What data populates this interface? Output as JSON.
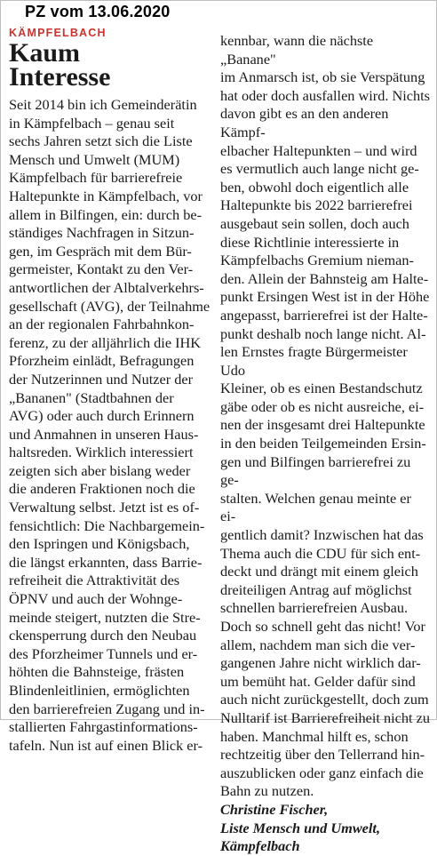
{
  "header": {
    "source_label": "PZ vom 13.06.2020"
  },
  "article": {
    "kicker": "KÄMPFELBACH",
    "title_line1": "Kaum",
    "title_line2": "Interesse",
    "left_lines": [
      "Seit 2014 bin ich Gemeinderätin",
      "in Kämpfelbach – genau seit",
      "sechs Jahren setzt sich die Liste",
      "Mensch und Umwelt (MUM)",
      "Kämpfelbach für barrierefreie",
      "Haltepunkte in Kämpfelbach, vor",
      "allem in Bilfingen, ein: durch be-",
      "ständiges Nachfragen in Sitzun-",
      "gen, im Gespräch mit dem Bür-",
      "germeister, Kontakt zu den Ver-",
      "antwortlichen der Albtalverkehrs-",
      "gesellschaft (AVG), der Teilnahme",
      "an der regionalen Fahrbahnkon-",
      "ferenz, zu der alljährlich die IHK",
      "Pforzheim einlädt, Befragungen",
      "der Nutzerinnen und Nutzer der",
      "„Bananen\" (Stadtbahnen der",
      "AVG) oder auch durch Erinnern",
      "und Anmahnen in unseren Haus-",
      "haltsreden. Wirklich interessiert",
      "zeigten sich aber bislang weder",
      "die anderen Fraktionen noch die",
      "Verwaltung selbst. Jetzt ist es of-",
      "fensichtlich: Die Nachbargemein-",
      "den Ispringen und Königsbach,",
      "die längst erkannten, dass Barrie-",
      "refreiheit die Attraktivität des",
      "ÖPNV und auch der Wohnge-",
      "meinde steigert, nutzten die Stre-",
      "ckensperrung durch den Neubau",
      "des Pforzheimer Tunnels und er-",
      "höhten die Bahnsteige, frästen",
      "Blindenleitlinien, ermöglichten",
      "den barrierefreien Zugang und in-",
      "stallierten Fahrgastinformations-",
      "tafeln. Nun ist auf einen Blick er-"
    ],
    "right_lines": [
      "kennbar, wann die nächste „Banane\"",
      "im Anmarsch ist, ob sie Verspätung",
      "hat oder doch ausfallen wird. Nichts",
      "davon gibt es an den anderen Kämpf-",
      "elbacher Haltepunkten – und wird",
      "es vermutlich auch lange nicht ge-",
      "ben, obwohl doch eigentlich alle",
      "Haltepunkte bis 2022 barrierefrei",
      "ausgebaut sein sollen, doch auch",
      "diese Richtlinie interessierte in",
      "Kämpfelbachs Gremium nieman-",
      "den. Allein der Bahnsteig am Halte-",
      "punkt Ersingen West ist in der Höhe",
      "angepasst, barrierefrei ist der Halte-",
      "punkt deshalb noch lange nicht. Al-",
      "len Ernstes fragte Bürgermeister Udo",
      "Kleiner, ob es einen Bestandschutz",
      "gäbe oder ob es nicht ausreiche, ei-",
      "nen der insgesamt drei Haltepunkte",
      "in den beiden Teilgemeinden Ersin-",
      "gen und Bilfingen barrierefrei zu ge-",
      "stalten. Welchen genau meinte er ei-",
      "gentlich damit? Inzwischen hat das",
      "Thema auch die CDU für sich ent-",
      "deckt und drängt mit einem gleich",
      "dreiteiligen Antrag auf möglichst",
      "schnellen barrierefreien Ausbau.",
      "Doch so schnell geht das nicht! Vor",
      "allem, nachdem man sich die ver-",
      "gangenen Jahre nicht wirklich dar-",
      "um bemüht hat. Gelder dafür sind",
      "auch nicht zurückgestellt, doch zum",
      "Nulltarif ist Barrierefreiheit nicht zu",
      "haben. Manchmal hilft es, schon",
      "rechtzeitig über den Tellerrand hin-",
      "auszublicken oder ganz einfach die",
      "Bahn zu nutzen."
    ],
    "signature_lines": [
      "Christine Fischer,",
      "Liste Mensch und Umwelt,",
      "Kämpfelbach"
    ]
  }
}
